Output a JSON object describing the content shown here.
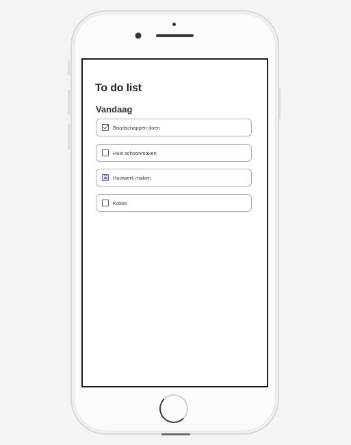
{
  "app": {
    "title": "To do list",
    "section_label": "Vandaag"
  },
  "tasks": [
    {
      "label": "Boodschappen doen",
      "status": "done",
      "icon": "checked-box-icon"
    },
    {
      "label": "Huis schoonmaken",
      "status": "open",
      "icon": "empty-checkbox-icon"
    },
    {
      "label": "Huiswerk maken",
      "status": "in-progress",
      "icon": "in-progress-checkbox-icon"
    },
    {
      "label": "Koken",
      "status": "open",
      "icon": "empty-checkbox-icon"
    }
  ],
  "colors": {
    "accent": "#6d57b3",
    "item_border": "#a9a6c9",
    "text": "#222222"
  }
}
